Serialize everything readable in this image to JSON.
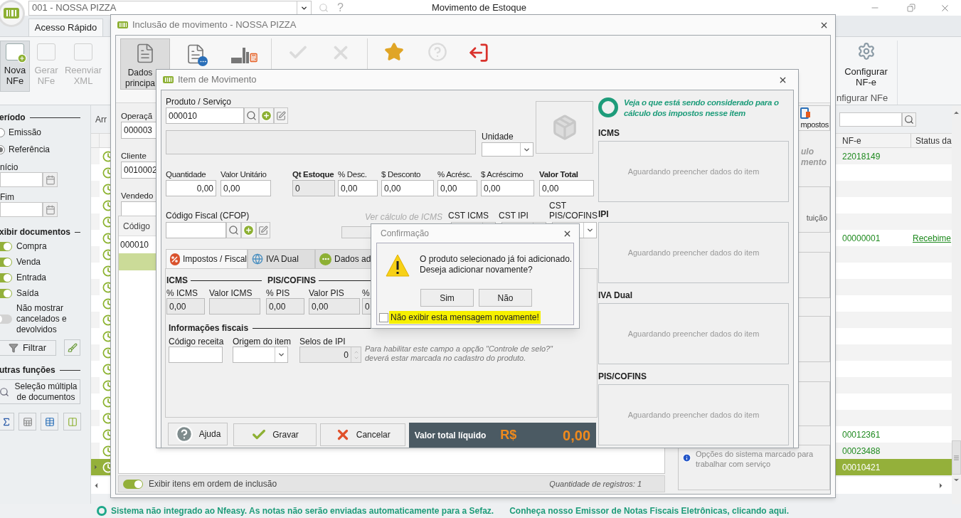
{
  "app": {
    "company": "001 - NOSSA PIZZA",
    "help": "?",
    "title": "Movimento de Estoque"
  },
  "ribbon_tabs": [
    {
      "label": "Acesso Rápido",
      "selected": true
    }
  ],
  "ribbon_buttons": [
    {
      "label": "Nova NFe",
      "selected": true,
      "disabled": false
    },
    {
      "label": "Gerar NFe",
      "selected": false,
      "disabled": true
    },
    {
      "label": "Reenviar XML",
      "selected": false,
      "disabled": true
    }
  ],
  "ribbon_group": {
    "button": "Configurar NF-e",
    "label": "nfigurar NFe"
  },
  "filters": {
    "period_title": "eríodo",
    "period_options": [
      {
        "label": "Emissão",
        "selected": false
      },
      {
        "label": "Referência",
        "selected": true
      }
    ],
    "start_label": "nício",
    "end_label": "Fim",
    "docs_title": "xibir documentos",
    "doc_toggles": [
      {
        "label": "Compra",
        "on": true
      },
      {
        "label": "Venda",
        "on": true
      },
      {
        "label": "Entrada",
        "on": true
      },
      {
        "label": "Saída",
        "on": true
      },
      {
        "label": "Não mostrar cancelados e devolvidos",
        "on": false
      }
    ],
    "filter_button": "Filtrar",
    "other_title": "utras funções",
    "multi_select_button": "Seleção múltipla de documentos"
  },
  "main_grid": {
    "group_hint": "Arr",
    "columns": [
      "NF-e",
      "Status da"
    ],
    "rows": [
      {
        "selected": false,
        "nfe": "22018149"
      },
      {
        "selected": false
      },
      {
        "selected": false
      },
      {
        "selected": false
      },
      {
        "selected": false
      },
      {
        "selected": false,
        "nfe": "00000001",
        "status": "Recebime"
      },
      {
        "selected": false
      },
      {
        "selected": false
      },
      {
        "selected": false
      },
      {
        "selected": false
      },
      {
        "selected": false
      },
      {
        "selected": false
      },
      {
        "selected": false
      },
      {
        "selected": false
      },
      {
        "selected": false
      },
      {
        "selected": false
      },
      {
        "selected": false
      },
      {
        "selected": false,
        "nfe": "00012361"
      },
      {
        "selected": false,
        "nfe": "00023488"
      },
      {
        "selected": true,
        "nfe": "00010421"
      }
    ]
  },
  "movement_window": {
    "title": "Inclusão de movimento - NOSSA PIZZA",
    "toolbar": [
      {
        "kind": "main",
        "label": "Dados principa",
        "selected": true,
        "disabled": false
      },
      {
        "kind": "notes",
        "selected": false,
        "disabled": false
      },
      {
        "kind": "calc",
        "selected": false,
        "disabled": false
      },
      {
        "kind": "confirm",
        "selected": false,
        "disabled": true
      },
      {
        "kind": "cancel",
        "selected": false,
        "disabled": true
      },
      {
        "kind": "favorite",
        "selected": false,
        "disabled": false
      },
      {
        "kind": "help",
        "selected": false,
        "disabled": true
      },
      {
        "kind": "exit",
        "selected": false,
        "disabled": false
      }
    ],
    "fields": [
      {
        "label": "Operaçã",
        "value": "000003"
      },
      {
        "label": "Cliente",
        "value": "0010002"
      },
      {
        "label": "Vendedo"
      }
    ],
    "grid": {
      "column": "Código",
      "rows": [
        {
          "code": "000010",
          "selected": false
        },
        {
          "selected": true
        }
      ]
    },
    "side": {
      "button": "mpostos",
      "note": "ulo mento",
      "box_text": "tuição",
      "info": "Opções do sistema marcado para trabalhar com serviço"
    },
    "footer": {
      "toggle_label": "Exibir itens em ordem de inclusão",
      "toggle_on": true,
      "count": "Quantidade de registros: 1"
    }
  },
  "item_window": {
    "title": "Item de Movimento",
    "product": {
      "label": "Produto / Serviço",
      "value": "000010"
    },
    "unit": {
      "label": "Unidade"
    },
    "values": [
      {
        "label": "Quantidade",
        "value": "0,00",
        "kind": "right",
        "bold": false
      },
      {
        "label": "Valor Unitário",
        "value": "0,00",
        "kind": "left",
        "bold": false
      },
      {
        "label": "Qt Estoque",
        "value": "0",
        "kind": "readonly",
        "bold": true
      },
      {
        "label": "% Desc.",
        "value": "0,00",
        "kind": "left",
        "bold": false
      },
      {
        "label": "$ Desconto",
        "value": "0,00",
        "kind": "left",
        "bold": false
      },
      {
        "label": "% Acrésc.",
        "value": "0,00",
        "kind": "left",
        "bold": false
      },
      {
        "label": "$ Acréscimo",
        "value": "0,00",
        "kind": "left",
        "bold": false
      },
      {
        "label": "Valor Total",
        "value": "0,00",
        "kind": "left",
        "bold": true
      }
    ],
    "cfop": {
      "label": "Código Fiscal (CFOP)",
      "link": "Ver cálculo de ICMS"
    },
    "cst": [
      {
        "label": "CST ICMS"
      },
      {
        "label": "CST IPI"
      },
      {
        "label": "CST PIS/COFINS"
      }
    ],
    "tabs": [
      {
        "label": "Impostos / Fiscal",
        "selected": true,
        "kind": "taxes"
      },
      {
        "label": "IVA Dual",
        "selected": false,
        "kind": "iva"
      },
      {
        "label": "Dados ad",
        "selected": false,
        "kind": "more"
      }
    ],
    "icms": {
      "title": "ICMS",
      "fields": [
        {
          "label": "% ICMS",
          "value": "0,00"
        },
        {
          "label": "Valor ICMS"
        }
      ]
    },
    "pis_cofins": {
      "title": "PIS/COFINS",
      "fields": [
        {
          "label": "% PIS",
          "value": "0,00"
        },
        {
          "label": "Valor PIS",
          "value": "0,00"
        },
        {
          "label": "%",
          "value": "0"
        }
      ]
    },
    "fiscal_info": {
      "title": "Informações fiscais",
      "revenue_code": {
        "label": "Código receita"
      },
      "origin": {
        "label": "Origem do item"
      },
      "ipi_seals": {
        "label": "Selos de IPI",
        "value": "0"
      },
      "note": "Para habilitar este campo a opção \"Controle de selo?\" deverá estar marcada no cadastro do produto."
    },
    "buttons": [
      {
        "label": "Ajuda",
        "kind": "help"
      },
      {
        "label": "Gravar",
        "kind": "save"
      },
      {
        "label": "Cancelar",
        "kind": "cancel"
      }
    ],
    "total": {
      "label": "Valor total líquido",
      "currency": "R$",
      "value": "0,00"
    },
    "tax_panel": {
      "heading": "Veja o que está sendo considerado para o cálculo dos impostos nesse item",
      "sections": [
        {
          "title": "ICMS",
          "status": "Aguardando preencher dados do item"
        },
        {
          "title": "IPI",
          "status": "Aguardando preencher dados do item"
        },
        {
          "title": "IVA Dual",
          "status": "Aguardando preencher dados do item"
        },
        {
          "title": "PIS/COFINS",
          "status": "Aguardando preencher dados do item"
        }
      ]
    }
  },
  "confirm_dialog": {
    "title": "Confirmação",
    "message_lines": [
      "O produto selecionado já foi adicionado.",
      "Deseja adicionar novamente?"
    ],
    "buttons": [
      "Sim",
      "Não"
    ],
    "dont_show": {
      "label": "Não exibir esta mensagem novamente!",
      "checked": false
    }
  },
  "status_bar": {
    "message": "Sistema não integrado ao Nfeasy. As notas não serão enviadas automaticamente para a Sefaz.",
    "link": "Conheça nosso Emissor de Notas Fiscais Eletrônicas, clicando aqui."
  }
}
